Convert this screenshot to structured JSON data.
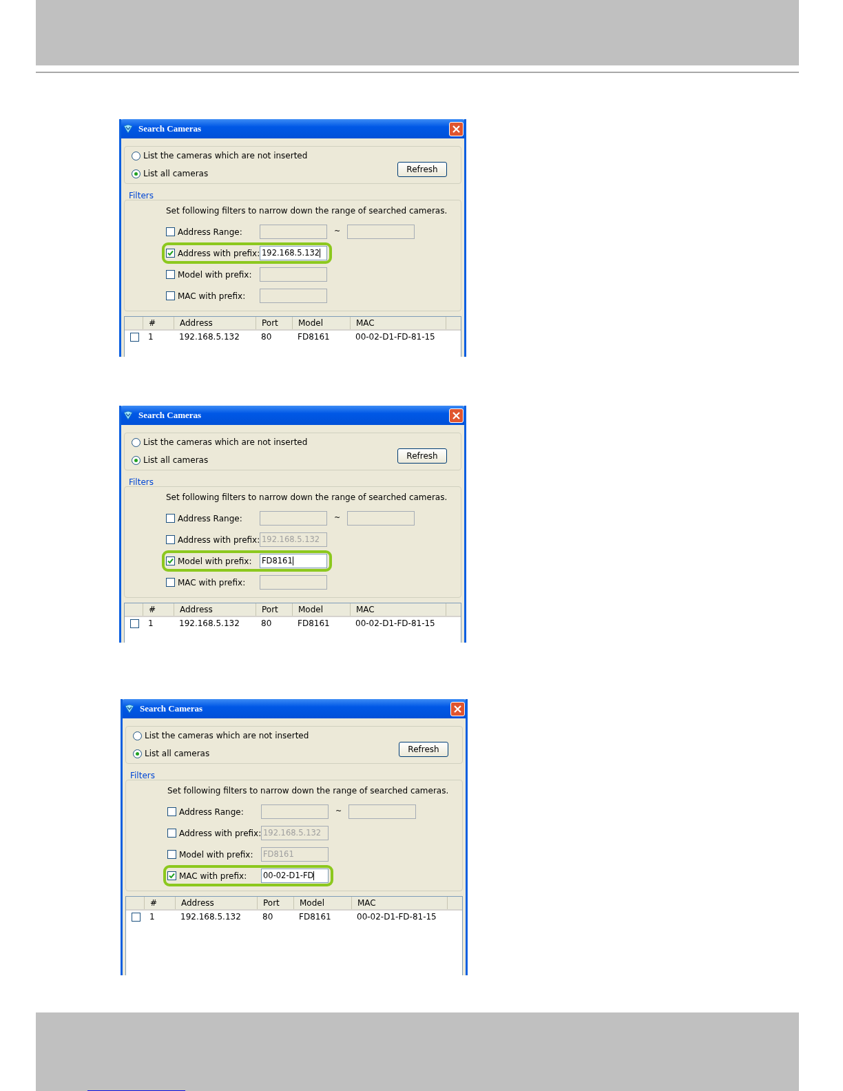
{
  "dialogs": [
    {
      "title": "Search Cameras",
      "radios": [
        {
          "label": "List the cameras which are not inserted",
          "selected": false
        },
        {
          "label": "List all cameras",
          "selected": true
        }
      ],
      "refresh": "Refresh",
      "filters_label": "Filters",
      "hint": "Set following filters to narrow down the range of searched cameras.",
      "filters": [
        {
          "kind": "range",
          "label": "Address Range:",
          "checked": false,
          "highlighted": false,
          "separator": "~"
        },
        {
          "kind": "prefix",
          "label": "Address with prefix:",
          "checked": true,
          "highlighted": true,
          "value": "192.168.5.132"
        },
        {
          "kind": "prefix",
          "label": "Model with prefix:",
          "checked": false,
          "highlighted": false
        },
        {
          "kind": "prefix",
          "label": "MAC with prefix:",
          "checked": false,
          "highlighted": false
        }
      ],
      "columns": [
        "#",
        "Address",
        "Port",
        "Model",
        "MAC"
      ],
      "rows": [
        {
          "checked": false,
          "cells": [
            "1",
            "192.168.5.132",
            "80",
            "FD8161",
            "00-02-D1-FD-81-15"
          ]
        }
      ]
    },
    {
      "title": "Search Cameras",
      "radios": [
        {
          "label": "List the cameras which are not inserted",
          "selected": false
        },
        {
          "label": "List all cameras",
          "selected": true
        }
      ],
      "refresh": "Refresh",
      "filters_label": "Filters",
      "hint": "Set following filters to narrow down the range of searched cameras.",
      "filters": [
        {
          "kind": "range",
          "label": "Address Range:",
          "checked": false,
          "highlighted": false,
          "separator": "~"
        },
        {
          "kind": "prefix",
          "label": "Address with prefix:",
          "checked": false,
          "highlighted": false,
          "value": "192.168.5.132"
        },
        {
          "kind": "prefix",
          "label": "Model with prefix:",
          "checked": true,
          "highlighted": true,
          "value": "FD8161"
        },
        {
          "kind": "prefix",
          "label": "MAC with prefix:",
          "checked": false,
          "highlighted": false
        }
      ],
      "columns": [
        "#",
        "Address",
        "Port",
        "Model",
        "MAC"
      ],
      "rows": [
        {
          "checked": false,
          "cells": [
            "1",
            "192.168.5.132",
            "80",
            "FD8161",
            "00-02-D1-FD-81-15"
          ]
        }
      ]
    },
    {
      "title": "Search Cameras",
      "radios": [
        {
          "label": "List the cameras which are not inserted",
          "selected": false
        },
        {
          "label": "List all cameras",
          "selected": true
        }
      ],
      "refresh": "Refresh",
      "filters_label": "Filters",
      "hint": "Set following filters to narrow down the range of searched cameras.",
      "filters": [
        {
          "kind": "range",
          "label": "Address Range:",
          "checked": false,
          "highlighted": false,
          "separator": "~"
        },
        {
          "kind": "prefix",
          "label": "Address with prefix:",
          "checked": false,
          "highlighted": false,
          "value": "192.168.5.132"
        },
        {
          "kind": "prefix",
          "label": "Model with prefix:",
          "checked": false,
          "highlighted": false,
          "value": "FD8161"
        },
        {
          "kind": "prefix",
          "label": "MAC with prefix:",
          "checked": true,
          "highlighted": true,
          "value": "00-02-D1-FD"
        }
      ],
      "columns": [
        "#",
        "Address",
        "Port",
        "Model",
        "MAC"
      ],
      "rows": [
        {
          "checked": false,
          "cells": [
            "1",
            "192.168.5.132",
            "80",
            "FD8161",
            "00-02-D1-FD-81-15"
          ]
        }
      ]
    }
  ]
}
